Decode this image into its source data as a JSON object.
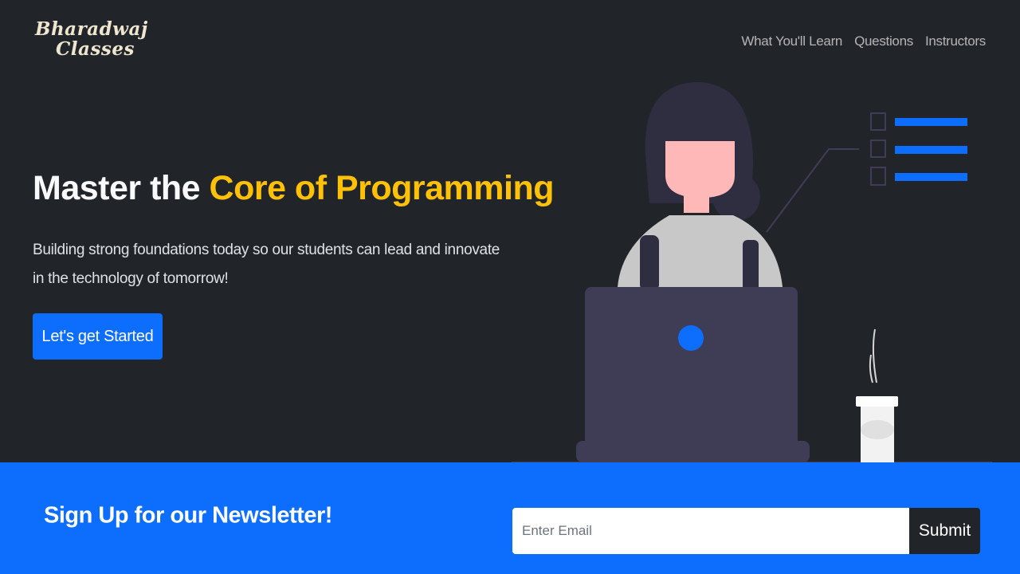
{
  "brand": {
    "line1": "Bharadwaj",
    "line2": "Classes"
  },
  "nav": {
    "items": [
      {
        "label": "What You'll Learn"
      },
      {
        "label": "Questions"
      },
      {
        "label": "Instructors"
      }
    ]
  },
  "hero": {
    "title_prefix": "Master the ",
    "title_accent": "Core of Programming",
    "subtitle": "Building strong foundations today so our students can lead and innovate in the technology of tomorrow!",
    "cta_label": "Let's get Started"
  },
  "newsletter": {
    "title": "Sign Up for our Newsletter!",
    "email_placeholder": "Enter Email",
    "submit_label": "Submit"
  },
  "colors": {
    "background": "#212529",
    "accent": "#ffc107",
    "primary": "#0d6efd",
    "logo": "#efe6cf"
  },
  "icons": {
    "illustration": "person-at-laptop-illustration"
  }
}
